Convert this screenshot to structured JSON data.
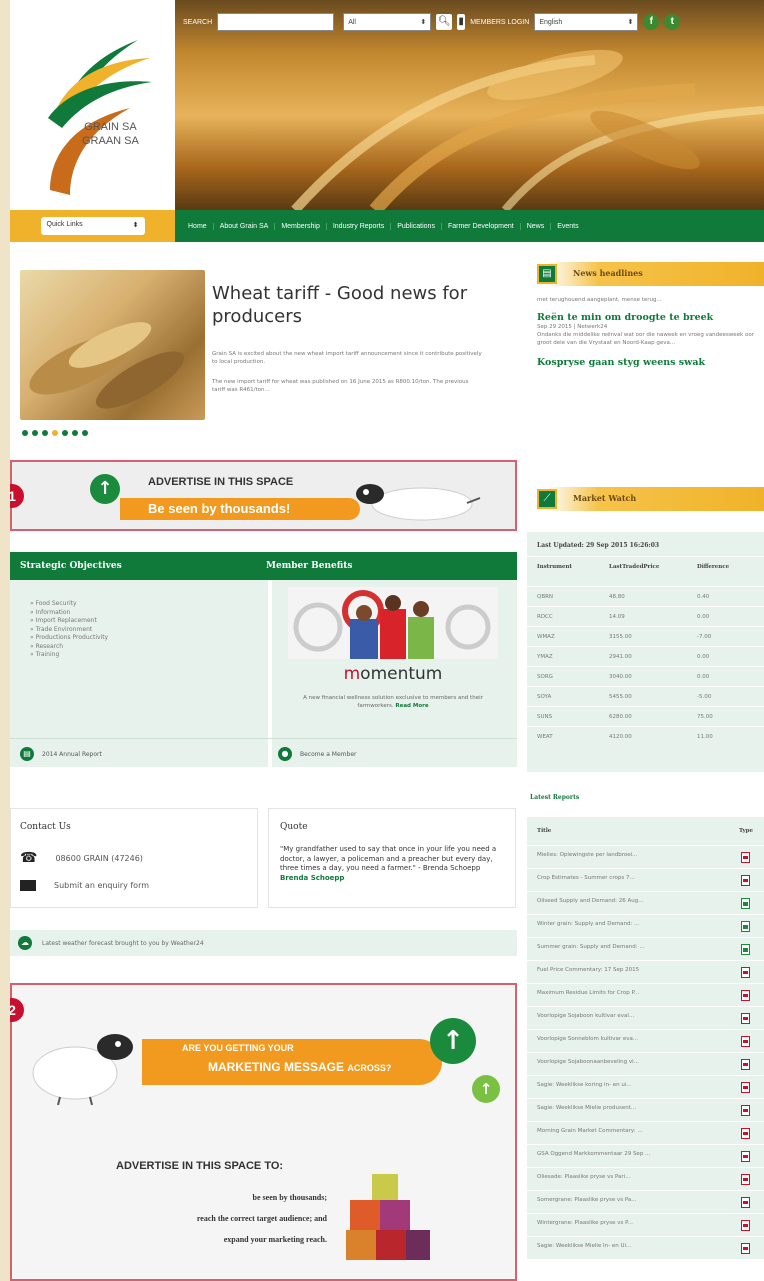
{
  "header": {
    "logo_line1": "GRAIN SA",
    "logo_line2": "GRAAN SA",
    "search_label": "SEARCH",
    "search_scope": "All",
    "members_login": "MEMBERS LOGIN",
    "language": "English"
  },
  "nav": {
    "quick_links": "Quick Links",
    "items": [
      "Home",
      "About Grain SA",
      "Membership",
      "Industry Reports",
      "Publications",
      "Farmer Development",
      "News",
      "Events"
    ]
  },
  "feature": {
    "title": "Wheat tariff - Good news for producers",
    "para1": "Grain SA is excited about the new wheat import tariff announcement since it contribute positively to local production.",
    "para2": "The new import tariff for wheat was published on 16 June 2015 as R800.10/ton. The previous tariff was R461/ton..."
  },
  "ad1": {
    "line1": "ADVERTISE IN THIS SPACE",
    "line2": "Be seen by thousands!",
    "badge": "1"
  },
  "objectives": {
    "heading_left": "Strategic Objectives",
    "heading_right": "Member Benefits",
    "items": [
      "Food Security",
      "Information",
      "Import Replacement",
      "Trade Environment",
      "Productions Productivity",
      "Research",
      "Training"
    ],
    "momentum_desc": "A new financial wellness solution exclusive to members and their farmworkers.",
    "read_more": "Read More",
    "footer_left": "2014 Annual Report",
    "footer_right": "Become a Member"
  },
  "contact": {
    "title": "Contact Us",
    "phone": "08600 GRAIN (47246)",
    "enquiry": "Submit an enquiry form"
  },
  "quote": {
    "title": "Quote",
    "text": "\"My grandfather used to say that once in your life you need a doctor, a lawyer, a policeman and a preacher but every day, three times a day, you need a farmer.\" - Brenda Schoepp",
    "author": "Brenda Schoepp"
  },
  "weather": {
    "text": "Latest weather forecast brought to you by Weather24"
  },
  "ad2": {
    "badge": "2",
    "line1": "ARE YOU GETTING YOUR",
    "line2": "MARKETING MESSAGE",
    "line2b": "ACROSS?",
    "heading": "ADVERTISE IN THIS SPACE TO:",
    "bullets": [
      "be seen by thousands;",
      "reach the correct target audience; and",
      "expand your marketing reach."
    ]
  },
  "news": {
    "title": "News headlines",
    "snippet_top": "met terughouend aangeplant, mense terug...",
    "item1_title": "Reën te min om droogte te breek",
    "item1_meta": "Sep 29 2015 | Netwerk24",
    "item1_text": "Ondanks die middelike reënval wat oor die naweek en vroeg vandeesweek oor groot dele van die Vrystaat en Noord-Kaap geva...",
    "item2_title": "Kospryse gaan styg weens swak"
  },
  "market": {
    "title": "Market Watch",
    "last_updated": "Last Updated: 29 Sep 2015 16:26:03",
    "columns": [
      "Instrument",
      "LastTradedPrice",
      "Difference"
    ],
    "rows": [
      [
        "QBRN",
        "48.80",
        "0.40"
      ],
      [
        "RDCC",
        "14.09",
        "0.00"
      ],
      [
        "WMAZ",
        "3155.00",
        "-7.00"
      ],
      [
        "YMAZ",
        "2941.00",
        "0.00"
      ],
      [
        "SORG",
        "3040.00",
        "0.00"
      ],
      [
        "SOYA",
        "5455.00",
        "-5.00"
      ],
      [
        "SUNS",
        "6280.00",
        "75.00"
      ],
      [
        "WEAT",
        "4120.00",
        "11.00"
      ]
    ]
  },
  "reports": {
    "title": "Latest Reports",
    "columns": [
      "Title",
      "Type"
    ],
    "rows": [
      {
        "title": "Mielies: Oplewingste per landbroei...",
        "type": "pdf"
      },
      {
        "title": "Crop Estimates - Summer crops 7...",
        "type": "pdf"
      },
      {
        "title": "Oilseed Supply and Demand: 26 Aug...",
        "type": "xls"
      },
      {
        "title": "Winter grain: Supply and Demand: ...",
        "type": "xls"
      },
      {
        "title": "Summer grain: Supply and Demand: ...",
        "type": "xls"
      },
      {
        "title": "Fuel Price Commentary: 17 Sep 2015",
        "type": "pdf"
      },
      {
        "title": "Maximum Residue Limits for Crop P...",
        "type": "pdf"
      },
      {
        "title": "Voorlopige Sojaboon kultivar eval...",
        "type": "pdf"
      },
      {
        "title": "Voorlopige Sonneblom kultivar eva...",
        "type": "pdf"
      },
      {
        "title": "Voorlopige Sojaboonaanbeveling vi...",
        "type": "pdf"
      },
      {
        "title": "Sagie: Weeklikse koring in- en ui...",
        "type": "pdf"
      },
      {
        "title": "Sagie: Weeklikse Mielie produsent...",
        "type": "pdf"
      },
      {
        "title": "Morning Grain Market Commentary: ...",
        "type": "pdf"
      },
      {
        "title": "GSA Oggend Markkommentaar 29 Sep ...",
        "type": "pdf"
      },
      {
        "title": "Oliesade: Plaaslike pryse vs Pari...",
        "type": "pdf"
      },
      {
        "title": "Somergrane: Plaaslike pryse vs Pa...",
        "type": "pdf"
      },
      {
        "title": "Wintergrane: Plaaslike pryse vs P...",
        "type": "pdf"
      },
      {
        "title": "Sagie: Weeklikse Mielie In- en Ui...",
        "type": "pdf"
      }
    ]
  },
  "colors": {
    "green": "#0f7a3a",
    "gold": "#f0b22a",
    "orange": "#f29a1f",
    "badge_red": "#c8102e",
    "ad_border": "#d46070"
  }
}
